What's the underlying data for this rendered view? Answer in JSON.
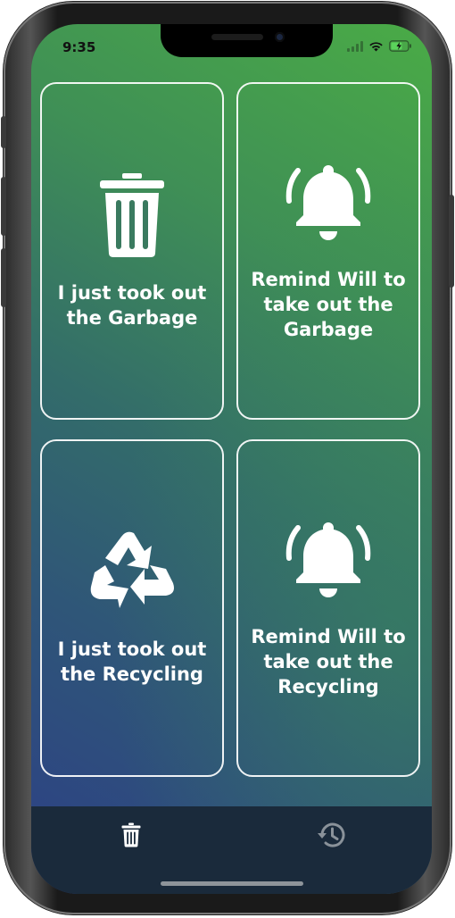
{
  "status_bar": {
    "time": "9:35"
  },
  "cards": [
    {
      "label": "I just took out\nthe Garbage",
      "icon": "trash-can-icon"
    },
    {
      "label": "Remind Will  to\ntake out the\nGarbage",
      "icon": "bell-ringing-icon"
    },
    {
      "label": "I just took out\nthe Recycling",
      "icon": "recycle-icon"
    },
    {
      "label": "Remind Will  to\ntake out the\nRecycling",
      "icon": "bell-ringing-icon"
    }
  ],
  "tab_bar": {
    "tabs": [
      {
        "icon": "trash-can-icon",
        "active": true
      },
      {
        "icon": "history-icon",
        "active": false
      }
    ]
  },
  "colors": {
    "gradient_top_right": "#4aab46",
    "gradient_bottom_left": "#2c3f86",
    "tab_bar_background": "#1a2a3b",
    "card_border": "#ffffff",
    "active_tab_icon": "#ffffff",
    "inactive_tab_icon": "#8a929a"
  }
}
